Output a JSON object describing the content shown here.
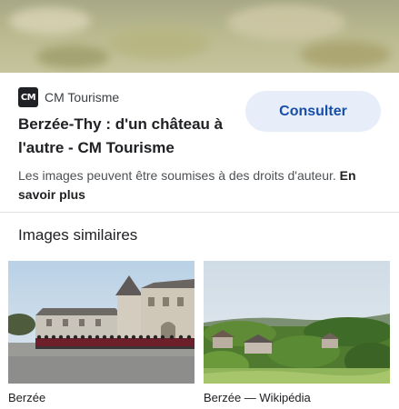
{
  "source": {
    "logo_text": "CM",
    "name": "CM Tourisme"
  },
  "result": {
    "title": "Berzée-Thy : d'un château à l'autre - CM Tourisme",
    "consult_label": "Consulter"
  },
  "notice": {
    "text": "Les images peuvent être soumises à des droits d'auteur.",
    "more_link": "En savoir plus"
  },
  "similar": {
    "heading": "Images similaires",
    "items": [
      {
        "caption": "Berzée"
      },
      {
        "caption": "Berzée — Wikipédia"
      }
    ]
  },
  "colors": {
    "button_bg": "#e8eef9",
    "button_text": "#174ea6"
  }
}
